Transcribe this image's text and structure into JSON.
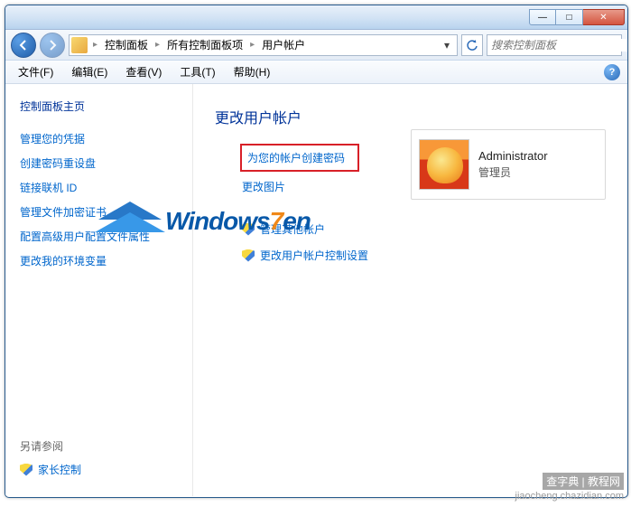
{
  "window": {
    "min": "—",
    "max": "□",
    "close": "✕"
  },
  "breadcrumb": {
    "items": [
      "控制面板",
      "所有控制面板项",
      "用户帐户"
    ]
  },
  "search": {
    "placeholder": "搜索控制面板"
  },
  "menu": {
    "items": [
      "文件(F)",
      "编辑(E)",
      "查看(V)",
      "工具(T)",
      "帮助(H)"
    ],
    "help": "?"
  },
  "sidebar": {
    "title": "控制面板主页",
    "links": [
      "管理您的凭据",
      "创建密码重设盘",
      "链接联机 ID",
      "管理文件加密证书",
      "配置高级用户配置文件属性",
      "更改我的环境变量"
    ],
    "footer_title": "另请参阅",
    "footer_link": "家长控制"
  },
  "main": {
    "title": "更改用户帐户",
    "tasks": {
      "create_password": "为您的帐户创建密码",
      "change_picture": "更改图片",
      "manage_other": "管理其他帐户",
      "change_uac": "更改用户帐户控制设置"
    }
  },
  "account": {
    "name": "Administrator",
    "role": "管理员"
  },
  "watermark": {
    "text1": "Windows",
    "text2": "7",
    "text3": "en"
  },
  "footer": {
    "main": "查字典 | 教程网",
    "sub": "jiaocheng.chazidian.com"
  }
}
